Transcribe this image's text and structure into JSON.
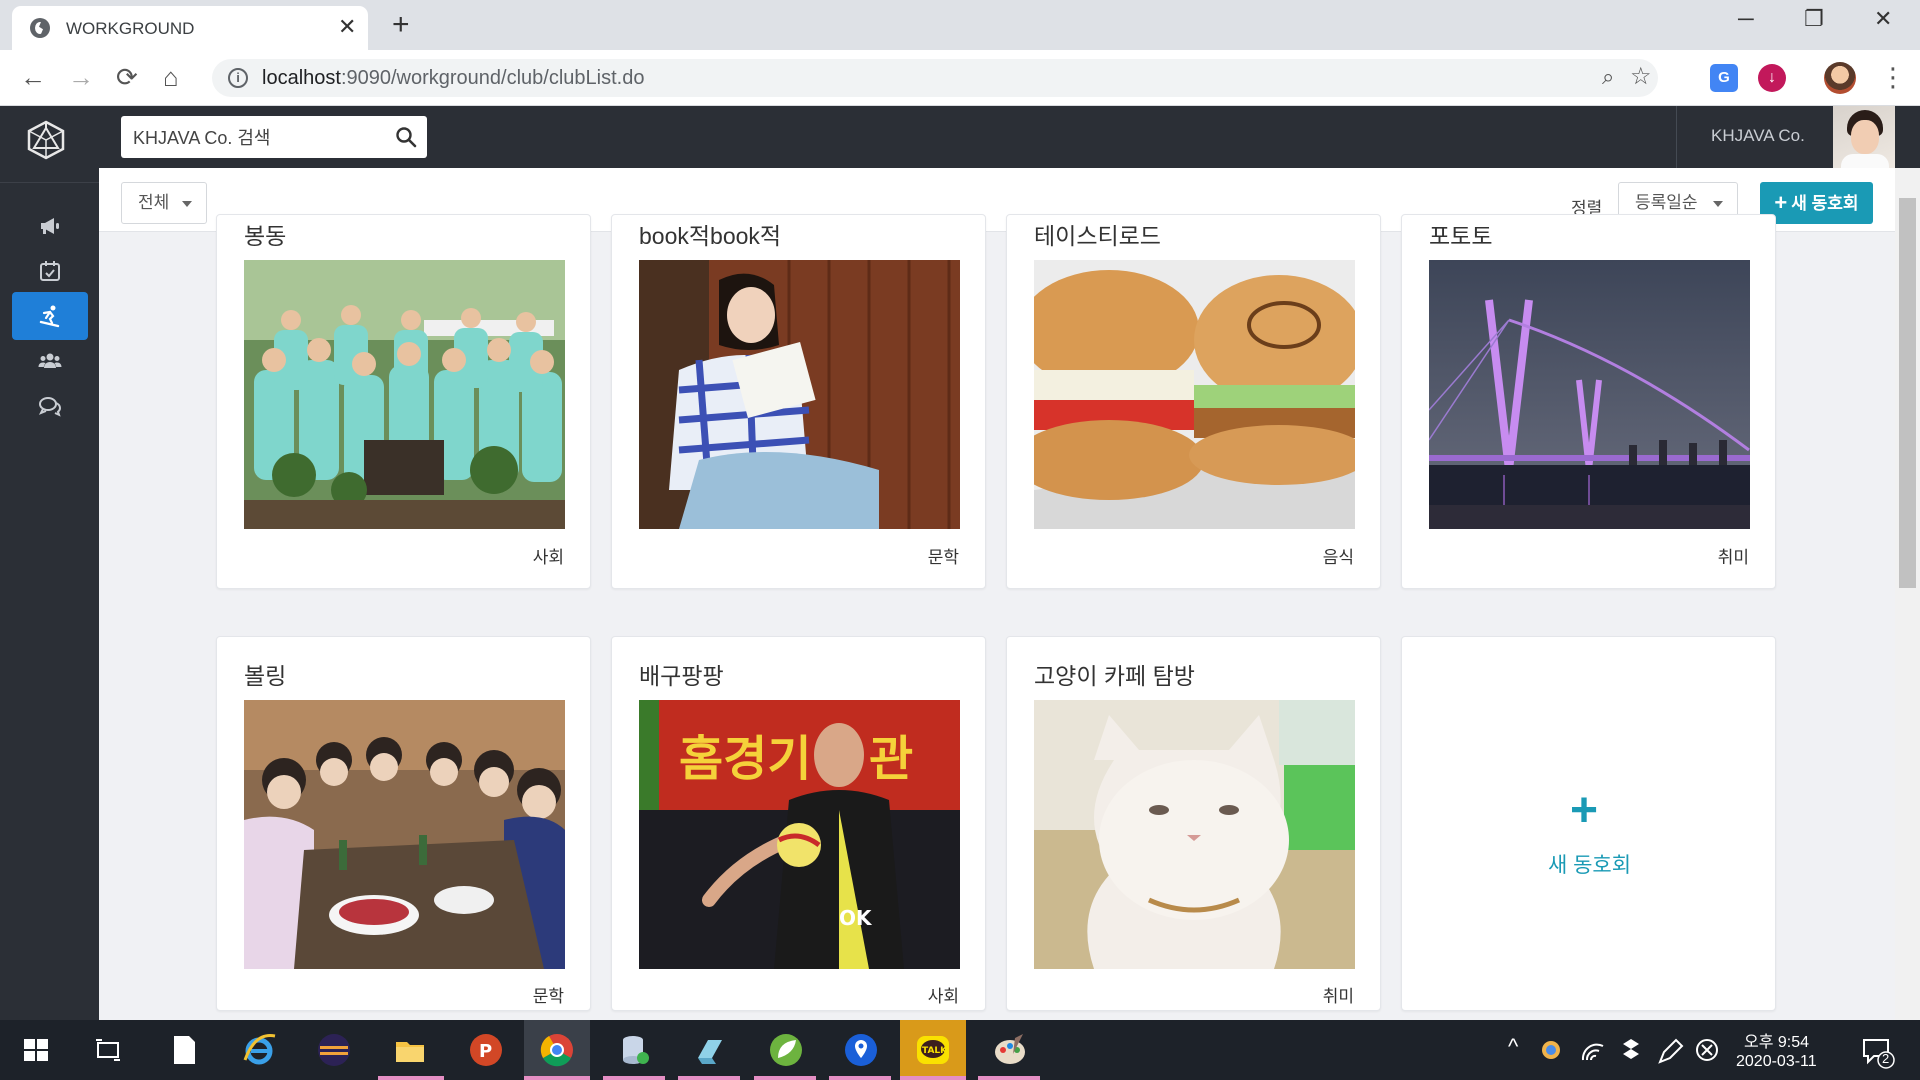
{
  "browser": {
    "tab_title": "WORKGROUND",
    "tab_close": "✕",
    "new_tab": "+",
    "url_host": "localhost",
    "url_rest": ":9090/workground/club/clubList.do",
    "translate_label": "G",
    "window_controls": [
      "─",
      "❐",
      "✕"
    ]
  },
  "topnav": {
    "search_value": "KHJAVA Co. 검색",
    "company_name": "KHJAVA Co."
  },
  "filters": {
    "category": "전체",
    "sort_label": "정렬",
    "sort_value": "등록일순",
    "new_club_label": "새 동호회",
    "new_club_plus": "+"
  },
  "clubs": [
    {
      "title": "봉동",
      "category": "사회",
      "icon": "volunteer-photo"
    },
    {
      "title": "book적book적",
      "category": "문학",
      "icon": "reading-photo"
    },
    {
      "title": "테이스티로드",
      "category": "음식",
      "icon": "burger-photo"
    },
    {
      "title": "포토토",
      "category": "취미",
      "icon": "bridge-night-photo"
    },
    {
      "title": "볼링",
      "category": "문학",
      "icon": "group-dinner-photo"
    },
    {
      "title": "배구팡팡",
      "category": "사회",
      "icon": "volleyball-photo"
    },
    {
      "title": "고양이 카페 탐방",
      "category": "취미",
      "icon": "cat-photo"
    }
  ],
  "add_card": {
    "plus": "+",
    "label": "새 동호회"
  },
  "sidebar_icons": [
    "megaphone-icon",
    "calendar-check-icon",
    "snowboard-icon",
    "users-icon",
    "comments-icon"
  ],
  "taskbar": {
    "time": "오후 9:54",
    "date": "2020-03-11",
    "notification_count": "2",
    "kakao_label": "TALK"
  },
  "colors": {
    "accent": "#1a9ab5",
    "sidebar_active": "#1f7fd8",
    "dark_nav": "#2b2f36"
  }
}
